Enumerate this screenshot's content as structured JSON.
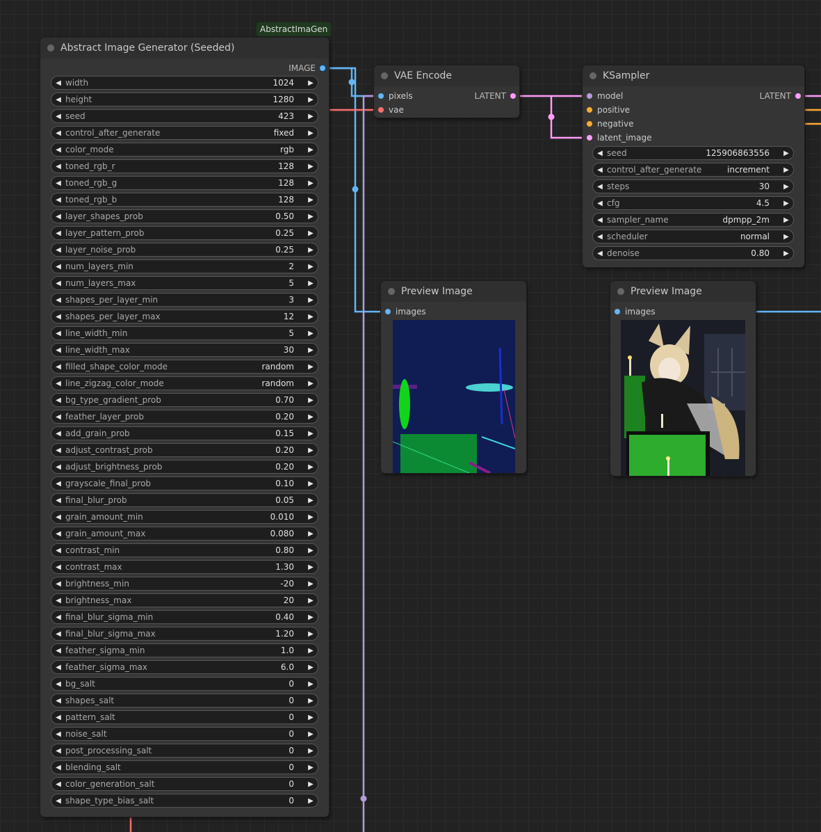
{
  "canvas": {
    "background": "#222222"
  },
  "colors": {
    "image": "#64b5f6",
    "latent": "#ff9cf9",
    "vae": "#ff6e6e",
    "model": "#b39ddb",
    "conditioning": "#ffa931"
  },
  "abstract_node": {
    "badge": "AbstractImaGen",
    "title": "Abstract Image Generator (Seeded)",
    "output_label": "IMAGE",
    "widgets": [
      {
        "label": "width",
        "value": "1024"
      },
      {
        "label": "height",
        "value": "1280"
      },
      {
        "label": "seed",
        "value": "423"
      },
      {
        "label": "control_after_generate",
        "value": "fixed"
      },
      {
        "label": "color_mode",
        "value": "rgb"
      },
      {
        "label": "toned_rgb_r",
        "value": "128"
      },
      {
        "label": "toned_rgb_g",
        "value": "128"
      },
      {
        "label": "toned_rgb_b",
        "value": "128"
      },
      {
        "label": "layer_shapes_prob",
        "value": "0.50"
      },
      {
        "label": "layer_pattern_prob",
        "value": "0.25"
      },
      {
        "label": "layer_noise_prob",
        "value": "0.25"
      },
      {
        "label": "num_layers_min",
        "value": "2"
      },
      {
        "label": "num_layers_max",
        "value": "5"
      },
      {
        "label": "shapes_per_layer_min",
        "value": "3"
      },
      {
        "label": "shapes_per_layer_max",
        "value": "12"
      },
      {
        "label": "line_width_min",
        "value": "5"
      },
      {
        "label": "line_width_max",
        "value": "30"
      },
      {
        "label": "filled_shape_color_mode",
        "value": "random"
      },
      {
        "label": "line_zigzag_color_mode",
        "value": "random"
      },
      {
        "label": "bg_type_gradient_prob",
        "value": "0.70"
      },
      {
        "label": "feather_layer_prob",
        "value": "0.20"
      },
      {
        "label": "add_grain_prob",
        "value": "0.15"
      },
      {
        "label": "adjust_contrast_prob",
        "value": "0.20"
      },
      {
        "label": "adjust_brightness_prob",
        "value": "0.20"
      },
      {
        "label": "grayscale_final_prob",
        "value": "0.10"
      },
      {
        "label": "final_blur_prob",
        "value": "0.05"
      },
      {
        "label": "grain_amount_min",
        "value": "0.010"
      },
      {
        "label": "grain_amount_max",
        "value": "0.080"
      },
      {
        "label": "contrast_min",
        "value": "0.80"
      },
      {
        "label": "contrast_max",
        "value": "1.30"
      },
      {
        "label": "brightness_min",
        "value": "-20"
      },
      {
        "label": "brightness_max",
        "value": "20"
      },
      {
        "label": "final_blur_sigma_min",
        "value": "0.40"
      },
      {
        "label": "final_blur_sigma_max",
        "value": "1.20"
      },
      {
        "label": "feather_sigma_min",
        "value": "1.0"
      },
      {
        "label": "feather_sigma_max",
        "value": "6.0"
      },
      {
        "label": "bg_salt",
        "value": "0"
      },
      {
        "label": "shapes_salt",
        "value": "0"
      },
      {
        "label": "pattern_salt",
        "value": "0"
      },
      {
        "label": "noise_salt",
        "value": "0"
      },
      {
        "label": "post_processing_salt",
        "value": "0"
      },
      {
        "label": "blending_salt",
        "value": "0"
      },
      {
        "label": "color_generation_salt",
        "value": "0"
      },
      {
        "label": "shape_type_bias_salt",
        "value": "0"
      }
    ]
  },
  "vae_encode": {
    "title": "VAE Encode",
    "inputs": [
      {
        "label": "pixels",
        "color": "#64b5f6"
      },
      {
        "label": "vae",
        "color": "#ff6e6e"
      }
    ],
    "output_label": "LATENT"
  },
  "ksampler": {
    "title": "KSampler",
    "inputs": [
      {
        "label": "model",
        "color": "#b39ddb"
      },
      {
        "label": "positive",
        "color": "#ffa931"
      },
      {
        "label": "negative",
        "color": "#ffa931"
      },
      {
        "label": "latent_image",
        "color": "#ff9cf9"
      }
    ],
    "output_label": "LATENT",
    "widgets": [
      {
        "label": "seed",
        "value": "125906863556"
      },
      {
        "label": "control_after_generate",
        "value": "increment"
      },
      {
        "label": "steps",
        "value": "30"
      },
      {
        "label": "cfg",
        "value": "4.5"
      },
      {
        "label": "sampler_name",
        "value": "dpmpp_2m"
      },
      {
        "label": "scheduler",
        "value": "normal"
      },
      {
        "label": "denoise",
        "value": "0.80"
      }
    ]
  },
  "preview1": {
    "title": "Preview Image",
    "input_label": "images"
  },
  "preview2": {
    "title": "Preview Image",
    "input_label": "images"
  }
}
